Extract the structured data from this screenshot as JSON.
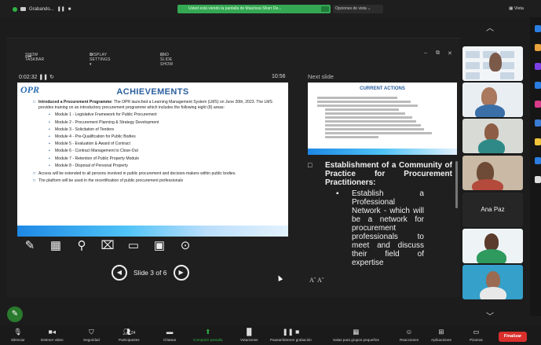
{
  "top_bar": {
    "recording": "Grabando...",
    "share_banner": "Usted está viendo la pantalla de Maurissa Sharr De...",
    "view_options": "Opciones de vista",
    "view_label": "Vista"
  },
  "presenter": {
    "toolbar": {
      "show_taskbar": "SHOW TASKBAR",
      "display_settings": "DISPLAY SETTINGS ▾",
      "end_slide_show": "END SLIDE SHOW"
    },
    "timer": "0:02:32",
    "clock": "10:56",
    "next_slide_label": "Next slide",
    "slide_counter": "Slide 3 of 6",
    "font_controls": "Aˆ  Aˇ"
  },
  "slide": {
    "logo": "OPR",
    "title": "ACHIEVEMENTS",
    "intro_bold": "Introduced a Procurement Programme",
    "intro_rest": ": The OPR launched a Learning Management System (LMS) on June 20th, 2023.  The LMS provides training on an introductory procurement programme which includes the following eight (8) areas:",
    "modules": [
      "Module 1 - Legislative Framework for Public Procurement",
      "Module 2 - Procurement Planning & Strategy Development",
      "Module 3 - Solicitation of Tenders",
      "Module 4 - Pre-Qualification for Public Bodies",
      "Module 5 - Evaluation & Award of Contract",
      "Module 6 - Contract Management to Close-Out",
      "Module 7 - Retention of Public Property Module",
      "Module 8 - Disposal of Personal Property"
    ],
    "bullet_access": "Access will be extended to all persons involved in public procurement and decision-makers within public bodies.",
    "bullet_platform": "The platform will be used in the recertification of public procurement professionals"
  },
  "next_slide": {
    "title": "CURRENT ACTIONS"
  },
  "notes": {
    "heading": "Establishment of a Community of Practice for Procurement Practitioners:",
    "sub": "Establish a Professional Network - which will be a network for procurement professionals to meet and discuss their field of expertise"
  },
  "gallery": {
    "name_tile": "Ana Paz"
  },
  "bottom_bar": {
    "items": [
      "Silenciar",
      "Detener video",
      "Seguridad",
      "Participantes",
      "Chatear",
      "Compartir pantalla",
      "Votaciones",
      "Pausar/detener grabación",
      "Salas para grupos pequeños",
      "Reacciones",
      "Aplicaciones",
      "Pizarras"
    ],
    "participants_count": "24",
    "end": "Finalizar"
  },
  "colors": {
    "accent_green": "#2fb344",
    "slide_title_blue": "#2b5f9e",
    "end_red": "#d9302c"
  }
}
